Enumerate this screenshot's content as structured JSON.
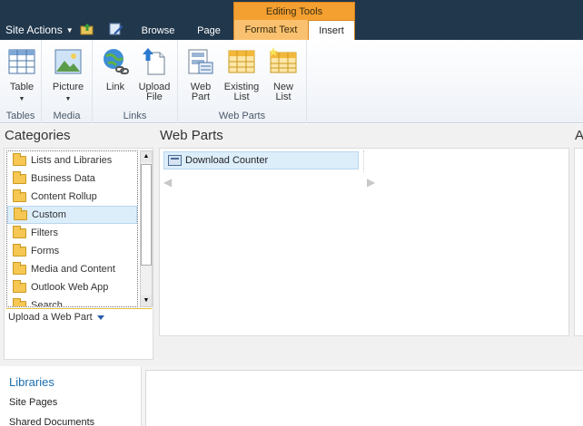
{
  "topbar": {
    "site_actions": "Site Actions",
    "tabs": [
      "Browse",
      "Page"
    ],
    "context_group": "Editing Tools",
    "context_tabs": [
      "Format Text",
      "Insert"
    ],
    "active_tab": "Insert"
  },
  "ribbon": {
    "groups": [
      {
        "label": "Tables",
        "buttons": [
          {
            "label": "Table",
            "icon": "table-icon",
            "dropdown": true
          }
        ]
      },
      {
        "label": "Media",
        "buttons": [
          {
            "label": "Picture",
            "icon": "picture-icon",
            "dropdown": true
          }
        ]
      },
      {
        "label": "Links",
        "buttons": [
          {
            "label": "Link",
            "icon": "link-icon"
          },
          {
            "label": "Upload File",
            "icon": "upload-file-icon"
          }
        ]
      },
      {
        "label": "Web Parts",
        "buttons": [
          {
            "label": "Web Part",
            "icon": "web-part-icon"
          },
          {
            "label": "Existing List",
            "icon": "existing-list-icon"
          },
          {
            "label": "New List",
            "icon": "new-list-icon"
          }
        ]
      }
    ]
  },
  "picker": {
    "categories_title": "Categories",
    "webparts_title": "Web Parts",
    "about_title": "A",
    "categories": [
      "Lists and Libraries",
      "Business Data",
      "Content Rollup",
      "Custom",
      "Filters",
      "Forms",
      "Media and Content",
      "Outlook Web App",
      "Search"
    ],
    "selected_category": "Custom",
    "web_parts": [
      "Download Counter"
    ],
    "upload_label": "Upload a Web Part"
  },
  "quicklaunch": {
    "title": "Libraries",
    "items": [
      "Site Pages",
      "Shared Documents"
    ]
  },
  "colors": {
    "topbar": "#21374c",
    "context_accent": "#f4a031",
    "selection": "#ddeefb",
    "link": "#1b6eaf"
  }
}
